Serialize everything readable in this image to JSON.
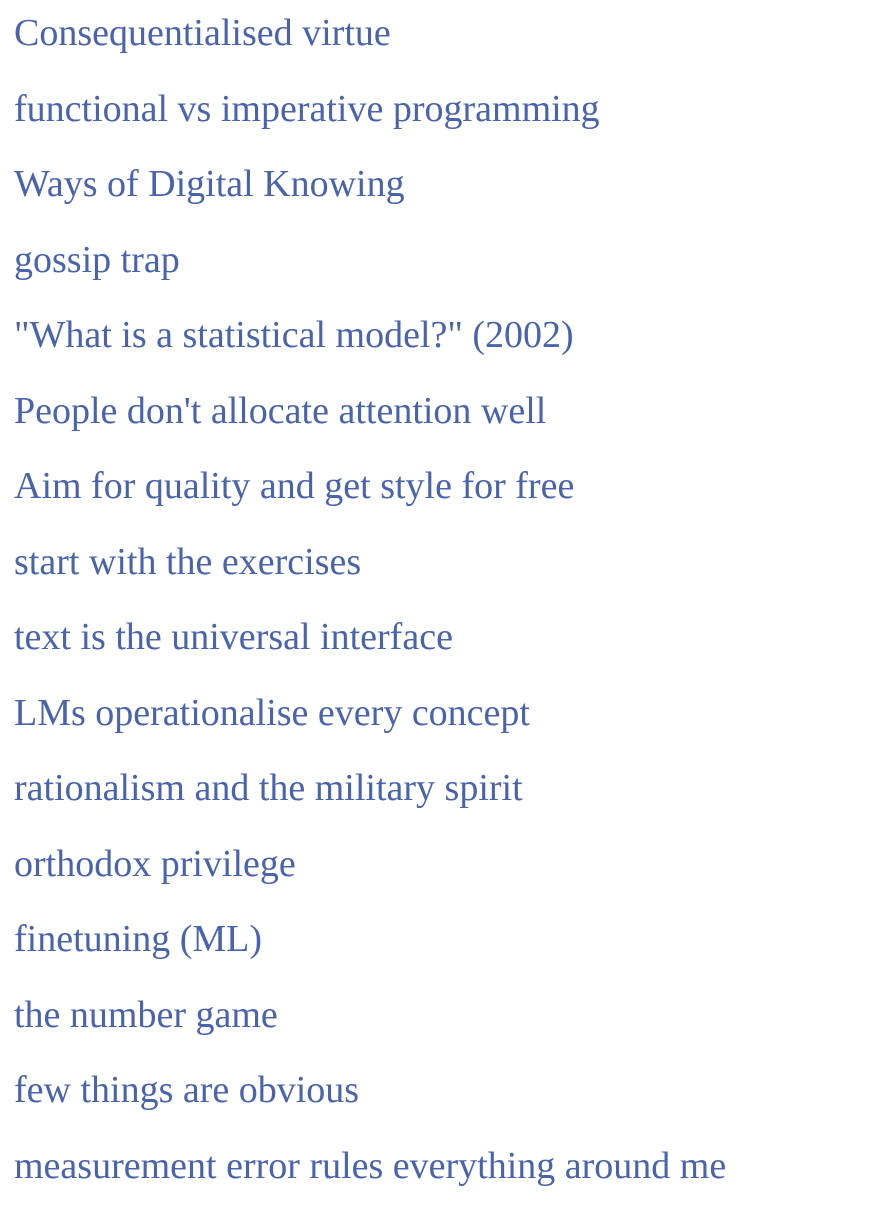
{
  "links": [
    {
      "label": "Consequentialised virtue"
    },
    {
      "label": "functional vs imperative programming"
    },
    {
      "label": "Ways of Digital Knowing"
    },
    {
      "label": "gossip trap"
    },
    {
      "label": "\"What is a statistical model?\" (2002)"
    },
    {
      "label": "People don't allocate attention well"
    },
    {
      "label": "Aim for quality and get style for free"
    },
    {
      "label": "start with the exercises"
    },
    {
      "label": "text is the universal interface"
    },
    {
      "label": "LMs operationalise every concept"
    },
    {
      "label": "rationalism and the military spirit"
    },
    {
      "label": "orthodox privilege"
    },
    {
      "label": "finetuning (ML)"
    },
    {
      "label": "the number game"
    },
    {
      "label": "few things are obvious"
    },
    {
      "label": "measurement error rules everything around me"
    }
  ],
  "colors": {
    "link": "#4a63ad",
    "background": "#ffffff"
  }
}
